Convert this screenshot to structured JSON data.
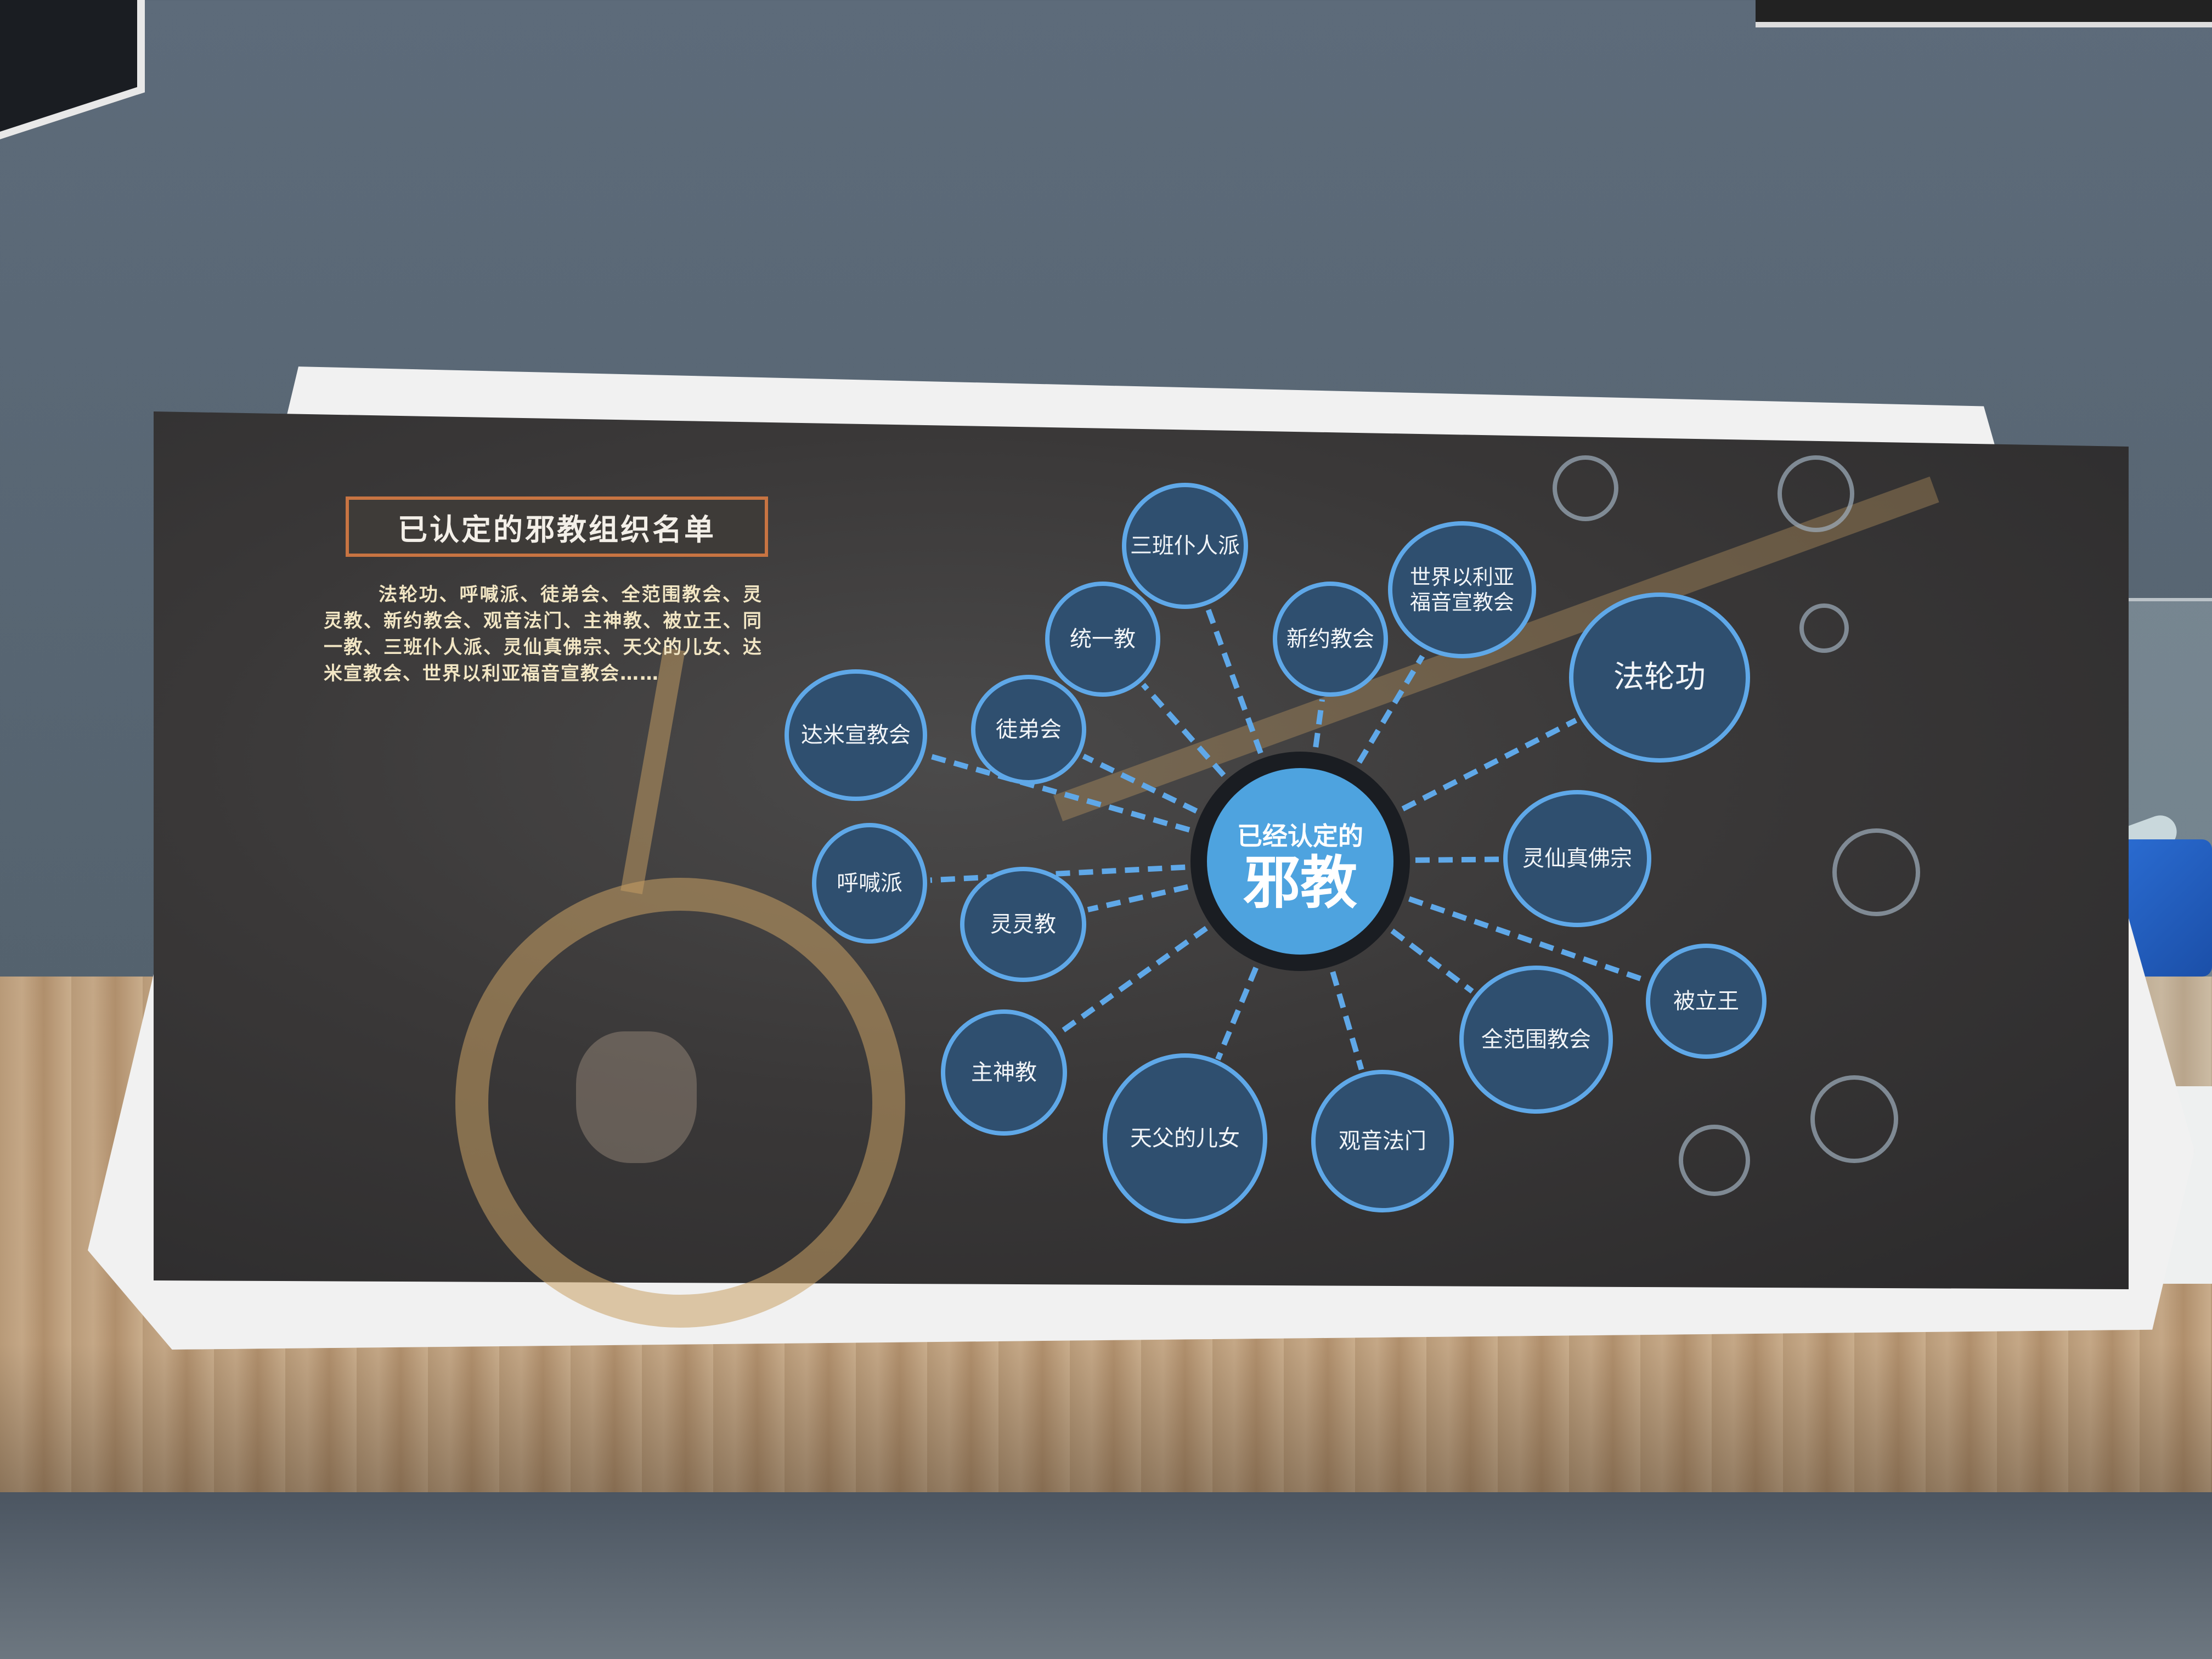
{
  "board": {
    "title": "已认定的邪教组织名单",
    "list_text": "法轮功、呼喊派、徒弟会、全范围教会、灵灵教、新约教会、观音法门、主神教、被立王、同一教、三班仆人派、灵仙真佛宗、天父的儿女、达米宣教会、世界以利亚福音宣教会……"
  },
  "center": {
    "subtitle": "已经认定的",
    "title": "邪教"
  },
  "nodes": [
    {
      "label": "三班仆人派"
    },
    {
      "label": "统一教"
    },
    {
      "label": "新约教会"
    },
    {
      "label": "世界以利亚\n福音宣教会"
    },
    {
      "label": "法轮功"
    },
    {
      "label": "达米宣教会"
    },
    {
      "label": "徒弟会"
    },
    {
      "label": "灵仙真佛宗"
    },
    {
      "label": "呼喊派"
    },
    {
      "label": "灵灵教"
    },
    {
      "label": "被立王"
    },
    {
      "label": "全范围教会"
    },
    {
      "label": "主神教"
    },
    {
      "label": "天父的儿女"
    },
    {
      "label": "观音法门"
    }
  ],
  "colors": {
    "node_border": "#5fa8e8",
    "node_fill": "#2f4f6f",
    "center_fill": "#4ea3df",
    "title_border": "#c87442",
    "list_text": "#f2e6c4"
  }
}
